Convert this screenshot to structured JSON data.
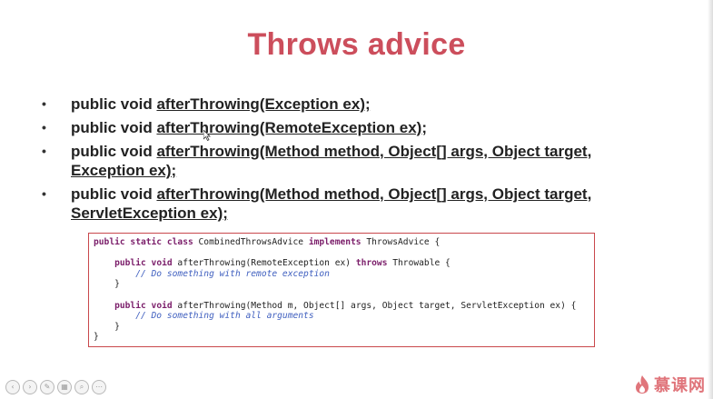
{
  "slide": {
    "title": "Throws advice",
    "bullets": [
      {
        "prefix": "public void ",
        "signature": "afterThrowing(Exception ex);",
        "continuation": ""
      },
      {
        "prefix": "public void ",
        "signature": "afterThrowing(RemoteException ex);",
        "continuation": ""
      },
      {
        "prefix": "public void ",
        "signature": "afterThrowing(Method method, Object[] args, Object target,",
        "continuation": "Exception ex);"
      },
      {
        "prefix": "public void ",
        "signature": "afterThrowing(Method method, Object[] args, Object target,",
        "continuation": "ServletException ex);"
      }
    ],
    "bullet_marker": "•",
    "code_lines": [
      [
        {
          "t": "public static class",
          "k": "kw"
        },
        {
          "t": " CombinedThrowsAdvice ",
          "k": ""
        },
        {
          "t": "implements",
          "k": "kw"
        },
        {
          "t": " ThrowsAdvice {",
          "k": ""
        }
      ],
      [],
      [
        {
          "t": "    ",
          "k": ""
        },
        {
          "t": "public void",
          "k": "kw"
        },
        {
          "t": " afterThrowing(RemoteException ex) ",
          "k": ""
        },
        {
          "t": "throws",
          "k": "kw"
        },
        {
          "t": " Throwable {",
          "k": ""
        }
      ],
      [
        {
          "t": "        // Do something with remote exception",
          "k": "cm"
        }
      ],
      [
        {
          "t": "    }",
          "k": ""
        }
      ],
      [],
      [
        {
          "t": "    ",
          "k": ""
        },
        {
          "t": "public void",
          "k": "kw"
        },
        {
          "t": " afterThrowing(Method m, Object[] args, Object target, ServletException ex) {",
          "k": ""
        }
      ],
      [
        {
          "t": "        // Do something with all arguments",
          "k": "cm"
        }
      ],
      [
        {
          "t": "    }",
          "k": ""
        }
      ],
      [
        {
          "t": "}",
          "k": ""
        }
      ]
    ]
  },
  "toolbar": {
    "buttons": [
      {
        "name": "prev-slide-button",
        "glyph": "‹"
      },
      {
        "name": "next-slide-button",
        "glyph": "›"
      },
      {
        "name": "pen-tool-button",
        "glyph": "✎"
      },
      {
        "name": "slide-sorter-button",
        "glyph": "▦"
      },
      {
        "name": "zoom-button",
        "glyph": "⌕"
      },
      {
        "name": "more-options-button",
        "glyph": "⋯"
      }
    ]
  },
  "branding": {
    "logo_text": "慕课网",
    "logo_color": "#e0757b"
  },
  "colors": {
    "title": "#cc4e5c",
    "code_border": "#c9484c",
    "keyword": "#7b1e6a",
    "comment": "#3f5fbf"
  }
}
